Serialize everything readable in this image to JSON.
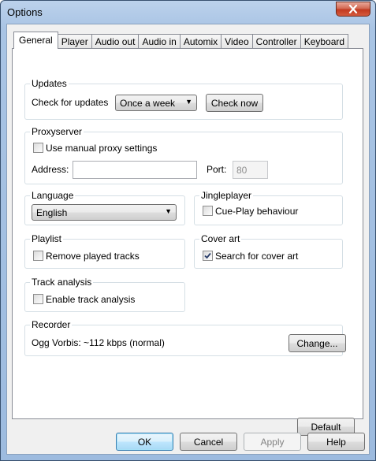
{
  "window": {
    "title": "Options",
    "close_label": "×"
  },
  "tabs": [
    {
      "label": "General",
      "active": true
    },
    {
      "label": "Player"
    },
    {
      "label": "Audio out"
    },
    {
      "label": "Audio in"
    },
    {
      "label": "Automix"
    },
    {
      "label": "Video"
    },
    {
      "label": "Controller"
    },
    {
      "label": "Keyboard"
    }
  ],
  "updates": {
    "title": "Updates",
    "check_label": "Check for updates",
    "frequency_value": "Once a week",
    "check_now_label": "Check now"
  },
  "proxy": {
    "title": "Proxyserver",
    "manual_label": "Use manual proxy settings",
    "manual_checked": false,
    "address_label": "Address:",
    "address_value": "",
    "port_label": "Port:",
    "port_value": "80"
  },
  "language": {
    "title": "Language",
    "value": "English"
  },
  "jingleplayer": {
    "title": "Jingleplayer",
    "cue_label": "Cue-Play behaviour",
    "cue_checked": false
  },
  "playlist": {
    "title": "Playlist",
    "remove_label": "Remove played tracks",
    "remove_checked": false
  },
  "cover_art": {
    "title": "Cover art",
    "search_label": "Search for cover art",
    "search_checked": true
  },
  "track_analysis": {
    "title": "Track analysis",
    "enable_label": "Enable track analysis",
    "enable_checked": false
  },
  "recorder": {
    "title": "Recorder",
    "format_text": "Ogg Vorbis: ~112 kbps (normal)",
    "change_label": "Change..."
  },
  "default_label": "Default",
  "footer": {
    "ok_label": "OK",
    "cancel_label": "Cancel",
    "apply_label": "Apply",
    "help_label": "Help"
  }
}
